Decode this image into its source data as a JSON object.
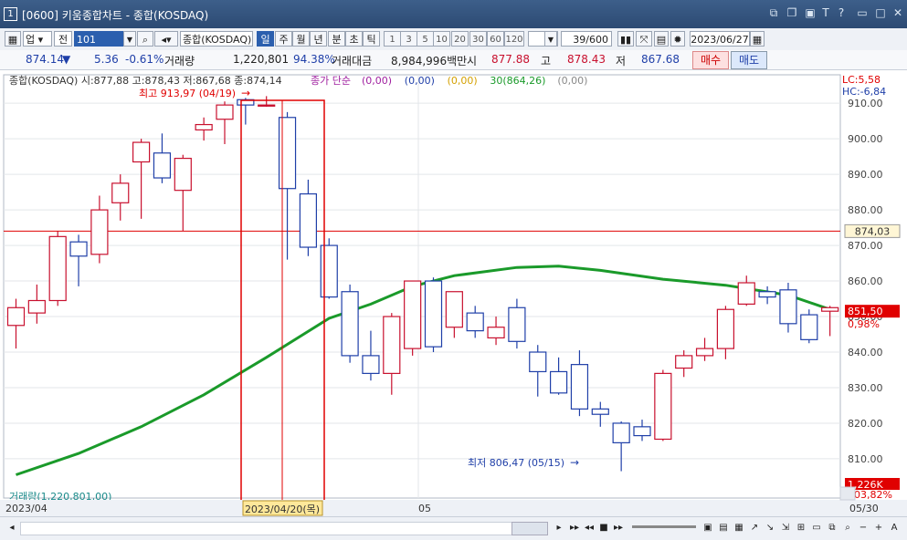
{
  "window": {
    "code": "[0600]",
    "title": "키움종합차트 - 종합(KOSDAQ)",
    "icon_label": "1"
  },
  "toolbar": {
    "market": "업",
    "prev_label": "전",
    "code_value": "101",
    "instrument": "종합(KOSDAQ)",
    "periods": [
      "일",
      "주",
      "월",
      "년",
      "분",
      "초",
      "틱"
    ],
    "active_period": "일",
    "intervals": [
      "1",
      "3",
      "5",
      "10",
      "20",
      "30",
      "60",
      "120"
    ],
    "count": "39/600",
    "date": "2023/06/27"
  },
  "infobar": {
    "price": "874.14",
    "change_arrow": "▼",
    "change": "5.36",
    "change_rate": "-0.61%",
    "volume_label": "거래량",
    "volume": "1,220,801",
    "volume_rate": "94.38%",
    "amount_label": "거래대금",
    "amount": "8,984,996백만",
    "open_label": "시",
    "open": "877.88",
    "high_label": "고",
    "high": "878.43",
    "low_label": "저",
    "low": "867.68",
    "buy_label": "매수",
    "sell_label": "매도"
  },
  "legend": {
    "ohlc": "종합(KOSDAQ) 시:877,88 고:878,43 저:867,68 종:874,14",
    "ma_label": "종가 단순",
    "ma_values": [
      {
        "text": "(0,00)",
        "color": "#a020a0"
      },
      {
        "text": "(0,00)",
        "color": "#1f3fa8"
      },
      {
        "text": "(0,00)",
        "color": "#d4a000"
      },
      {
        "text": "30(864,26)",
        "color": "#1a9a2a"
      },
      {
        "text": "(0,00)",
        "color": "#888888"
      }
    ]
  },
  "side_indicators": {
    "lc": "LC:5,58",
    "hc": "HC:-6,84"
  },
  "annotations": {
    "high": "최고 913,97 (04/19)",
    "low": "최저 806,47 (05/15)"
  },
  "bottom": {
    "volume_label": "거래량(1,220,801,00)",
    "volume_value": "1,226K",
    "volume_rate": "103,82%",
    "current_price_label": "874,03",
    "last_close_label": "851,50",
    "last_change_label": "0,98%",
    "date_labels": [
      "2023/04",
      "05",
      "05/30"
    ],
    "selected_date": "2023/04/20(목)"
  },
  "colors": {
    "up": "#c8102e",
    "down": "#1f3fa8",
    "ma30": "#1a9a2a",
    "highlight": "#e00000"
  },
  "chart_data": {
    "type": "candlestick",
    "y_axis_ticks": [
      910,
      900,
      890,
      880,
      870,
      860,
      850,
      840,
      830,
      820,
      810
    ],
    "ylim": [
      801,
      918
    ],
    "reference_line": 874.03,
    "candles": [
      {
        "o": 847.5,
        "h": 855,
        "l": 841,
        "c": 852.5
      },
      {
        "o": 851,
        "h": 859,
        "l": 848,
        "c": 854.5
      },
      {
        "o": 854.5,
        "h": 874,
        "l": 853,
        "c": 872.5
      },
      {
        "o": 871,
        "h": 873,
        "l": 858.5,
        "c": 867
      },
      {
        "o": 867.5,
        "h": 884,
        "l": 865,
        "c": 880
      },
      {
        "o": 882,
        "h": 890,
        "l": 877,
        "c": 887.5
      },
      {
        "o": 893.5,
        "h": 900,
        "l": 877.5,
        "c": 899
      },
      {
        "o": 896,
        "h": 901.5,
        "l": 887.5,
        "c": 889
      },
      {
        "o": 885.5,
        "h": 895.5,
        "l": 874,
        "c": 894.5
      },
      {
        "o": 902.5,
        "h": 906,
        "l": 899.5,
        "c": 904
      },
      {
        "o": 905.5,
        "h": 910.5,
        "l": 898.5,
        "c": 909.5
      },
      {
        "o": 911,
        "h": 911.5,
        "l": 904,
        "c": 909.5
      },
      {
        "o": 909.5,
        "h": 912,
        "l": 909,
        "c": 909.5
      },
      {
        "o": 906,
        "h": 907.5,
        "l": 866,
        "c": 886
      },
      {
        "o": 884.5,
        "h": 888.5,
        "l": 867,
        "c": 869.5
      },
      {
        "o": 870,
        "h": 872,
        "l": 855,
        "c": 855.5
      },
      {
        "o": 857,
        "h": 859,
        "l": 837,
        "c": 839
      },
      {
        "o": 839,
        "h": 846,
        "l": 832,
        "c": 834
      },
      {
        "o": 834,
        "h": 851,
        "l": 828,
        "c": 850
      },
      {
        "o": 841,
        "h": 851.5,
        "l": 839,
        "c": 860
      },
      {
        "o": 860,
        "h": 861,
        "l": 840,
        "c": 841.5
      },
      {
        "o": 847,
        "h": 857,
        "l": 844,
        "c": 857
      },
      {
        "o": 851,
        "h": 853,
        "l": 844,
        "c": 846
      },
      {
        "o": 844,
        "h": 850,
        "l": 842,
        "c": 847
      },
      {
        "o": 852.5,
        "h": 855,
        "l": 841,
        "c": 843
      },
      {
        "o": 840,
        "h": 842,
        "l": 827.5,
        "c": 834.5
      },
      {
        "o": 834.5,
        "h": 838.5,
        "l": 828,
        "c": 828.5
      },
      {
        "o": 836.5,
        "h": 840.5,
        "l": 822,
        "c": 824
      },
      {
        "o": 824,
        "h": 826,
        "l": 819,
        "c": 822.5
      },
      {
        "o": 820,
        "h": 820.5,
        "l": 806.5,
        "c": 814.5
      },
      {
        "o": 819,
        "h": 821,
        "l": 815,
        "c": 816.5
      },
      {
        "o": 815.5,
        "h": 835,
        "l": 815,
        "c": 834
      },
      {
        "o": 835.5,
        "h": 840.5,
        "l": 833,
        "c": 839
      },
      {
        "o": 839,
        "h": 844,
        "l": 837.5,
        "c": 841
      },
      {
        "o": 841,
        "h": 853,
        "l": 838,
        "c": 852
      },
      {
        "o": 853.5,
        "h": 861.5,
        "l": 853,
        "c": 859.5
      },
      {
        "o": 857,
        "h": 858.5,
        "l": 853.5,
        "c": 855.5
      },
      {
        "o": 857.5,
        "h": 859.5,
        "l": 845.5,
        "c": 848
      },
      {
        "o": 850.5,
        "h": 852,
        "l": 842.5,
        "c": 843.5
      },
      {
        "o": 851.5,
        "h": 853,
        "l": 844.5,
        "c": 852.5
      }
    ],
    "ma30": [
      [
        0,
        805.5
      ],
      [
        3,
        811.5
      ],
      [
        6,
        819
      ],
      [
        9,
        828
      ],
      [
        12,
        838.5
      ],
      [
        15,
        849.5
      ],
      [
        17,
        853.5
      ],
      [
        19,
        858.5
      ],
      [
        21,
        861.5
      ],
      [
        24,
        863.8
      ],
      [
        26,
        864.2
      ],
      [
        28,
        863
      ],
      [
        31,
        860.5
      ],
      [
        34,
        858.8
      ],
      [
        37,
        856
      ],
      [
        39,
        852
      ]
    ]
  }
}
